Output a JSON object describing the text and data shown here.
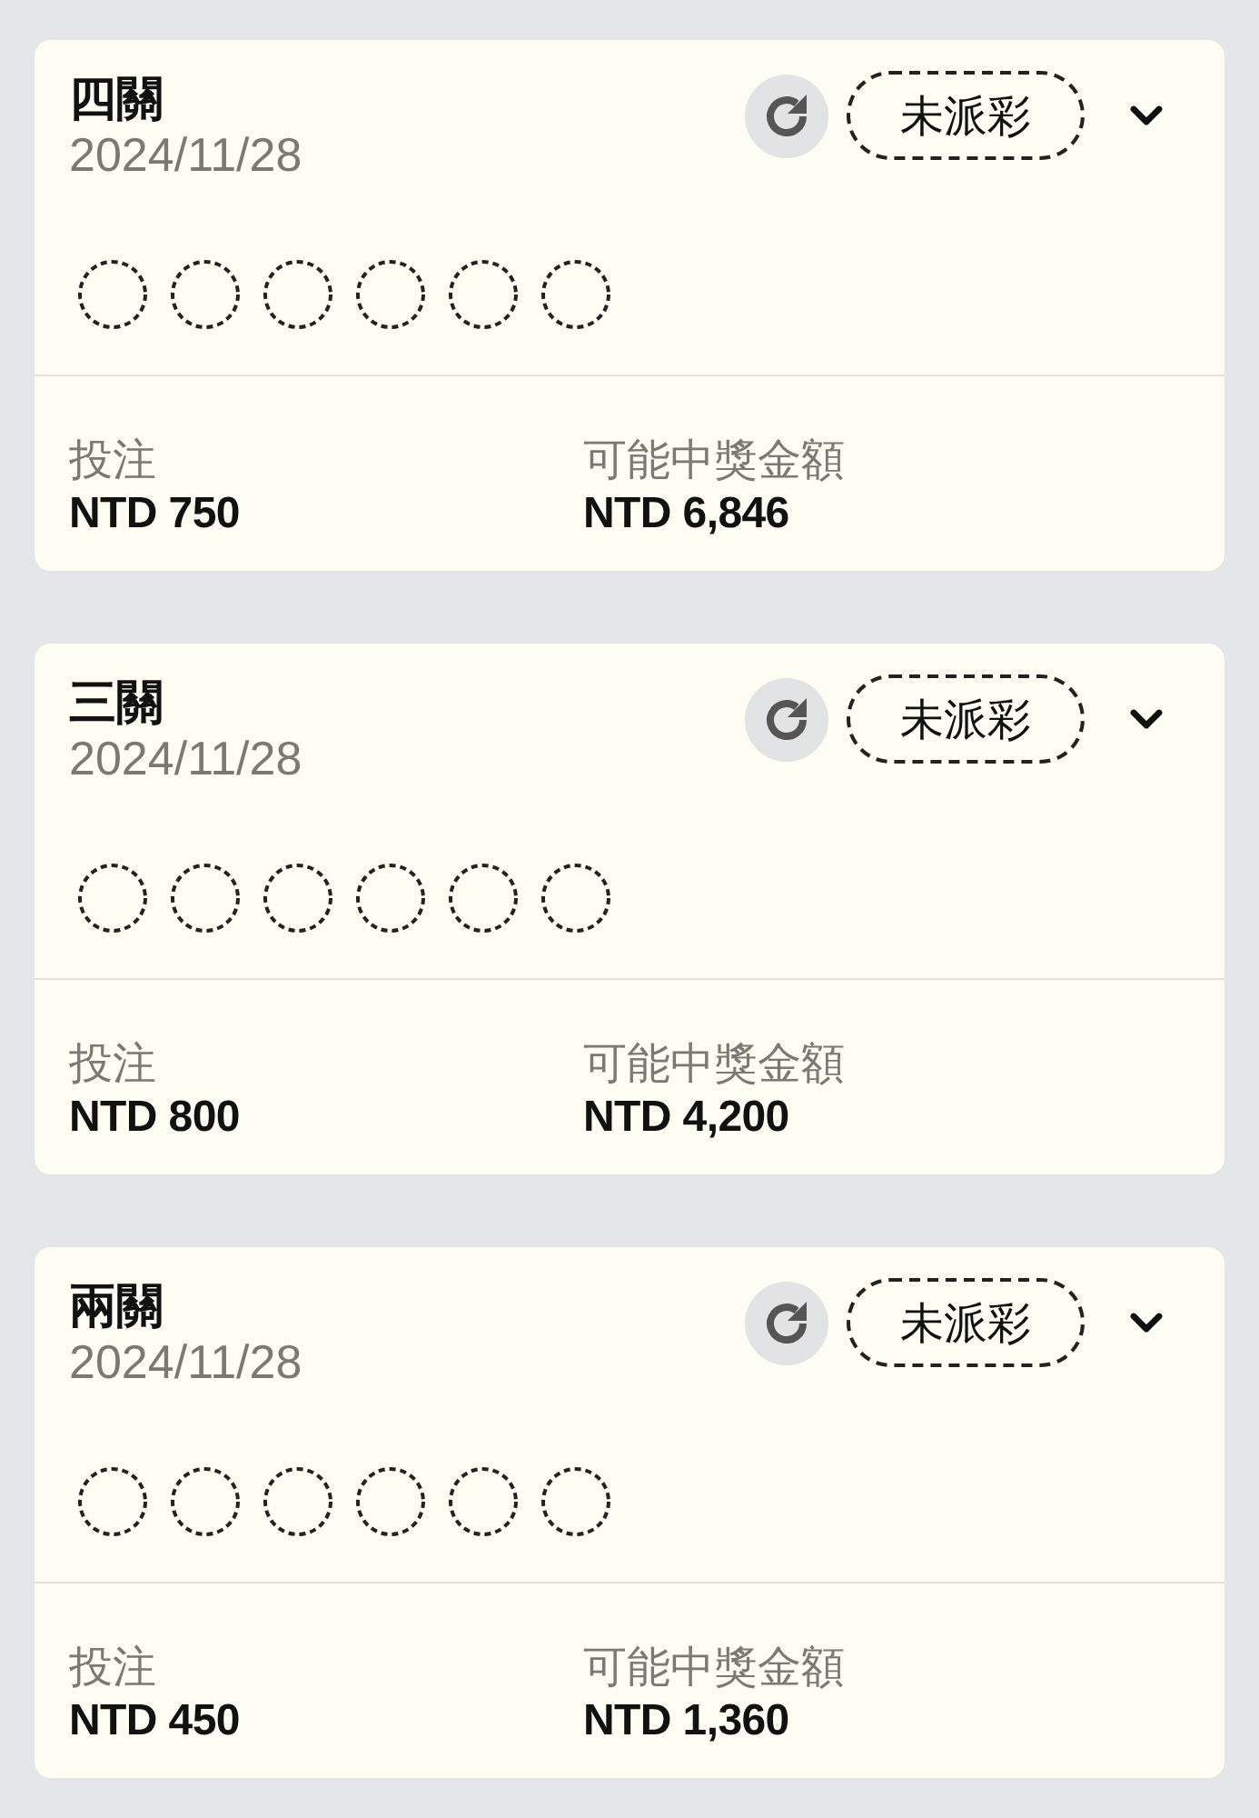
{
  "bets": [
    {
      "title": "四關",
      "date": "2024/11/28",
      "status": "未派彩",
      "expanded": false,
      "slots": [
        {
          "filled": false
        },
        {
          "filled": false
        },
        {
          "filled": false
        },
        {
          "filled": false
        },
        {
          "filled": false
        },
        {
          "filled": false
        }
      ],
      "stake_label": "投注",
      "stake": "NTD 750",
      "payout_label": "可能中獎金額",
      "payout": "NTD 6,846"
    },
    {
      "title": "三關",
      "date": "2024/11/28",
      "status": "未派彩",
      "expanded": false,
      "slots": [
        {
          "filled": false
        },
        {
          "filled": false
        },
        {
          "filled": false
        },
        {
          "filled": false
        },
        {
          "filled": false
        },
        {
          "filled": false
        }
      ],
      "stake_label": "投注",
      "stake": "NTD 800",
      "payout_label": "可能中獎金額",
      "payout": "NTD 4,200"
    },
    {
      "title": "兩關",
      "date": "2024/11/28",
      "status": "未派彩",
      "expanded": false,
      "slots": [
        {
          "filled": false
        },
        {
          "filled": false
        },
        {
          "filled": false
        },
        {
          "filled": false
        },
        {
          "filled": false
        },
        {
          "filled": false
        }
      ],
      "stake_label": "投注",
      "stake": "NTD 450",
      "payout_label": "可能中獎金額",
      "payout": "NTD 1,360"
    }
  ]
}
